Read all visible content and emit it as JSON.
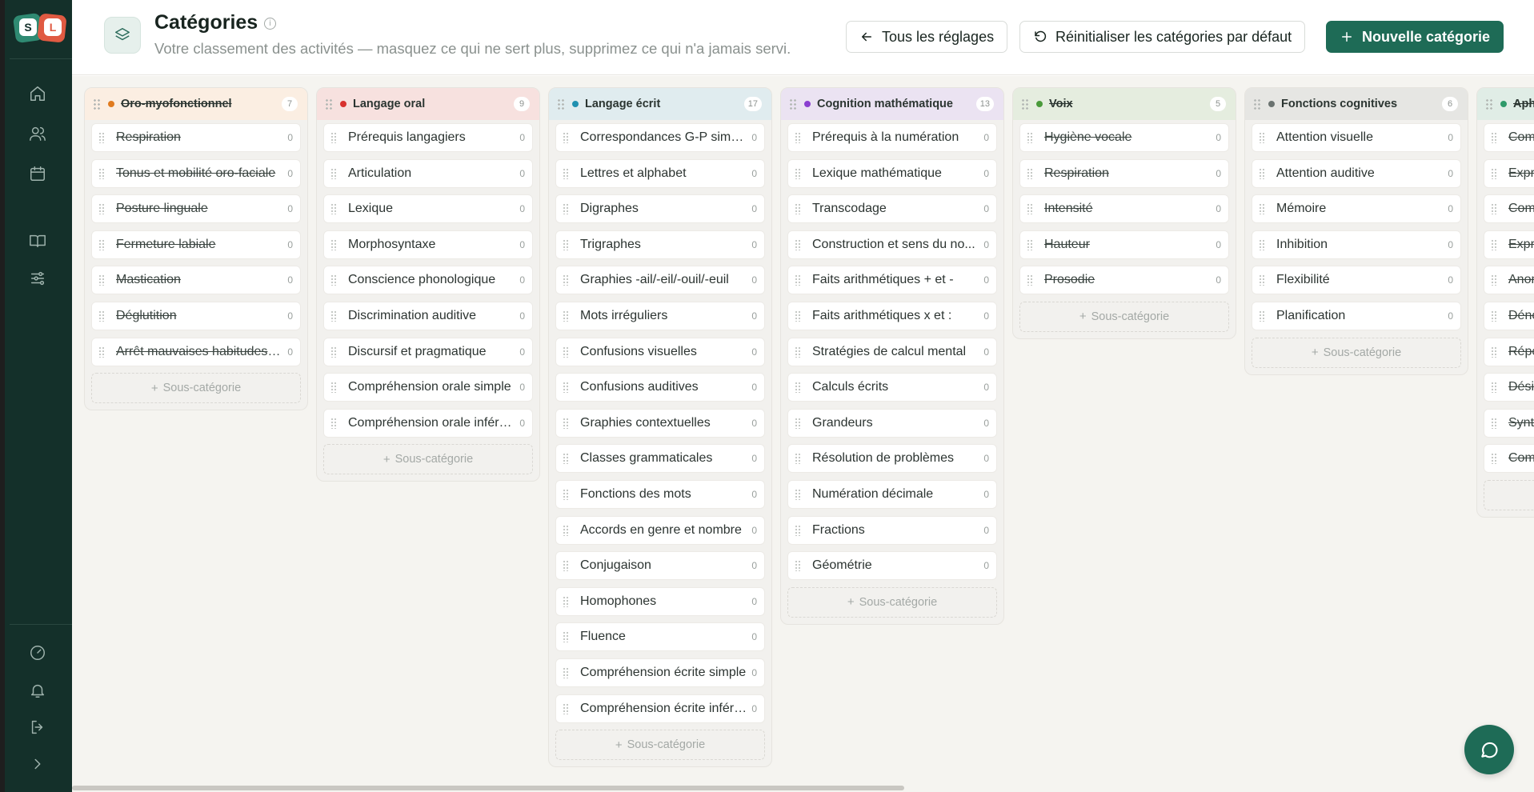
{
  "header": {
    "title": "Catégories",
    "subtitle": "Votre classement des activités — masquez ce qui ne sert plus, supprimez ce qui n'a jamais servi.",
    "back_label": "Tous les réglages",
    "reset_label": "Réinitialiser les catégories par défaut",
    "new_label": "Nouvelle catégorie"
  },
  "add_sub_label": "Sous-catégorie",
  "columns": [
    {
      "name": "Oro-myofonctionnel",
      "count": "7",
      "color": "#e07b1f",
      "head_bg": "#fbeee2",
      "archived": true,
      "items": [
        {
          "label": "Respiration",
          "count": "0",
          "archived": true
        },
        {
          "label": "Tonus et mobilité oro-faciale",
          "count": "0",
          "archived": true
        },
        {
          "label": "Posture linguale",
          "count": "0",
          "archived": true
        },
        {
          "label": "Fermeture labiale",
          "count": "0",
          "archived": true
        },
        {
          "label": "Mastication",
          "count": "0",
          "archived": true
        },
        {
          "label": "Déglutition",
          "count": "0",
          "archived": true
        },
        {
          "label": "Arrêt mauvaises habitudes ?...",
          "count": "0",
          "archived": true
        }
      ]
    },
    {
      "name": "Langage oral",
      "count": "9",
      "color": "#d8322f",
      "head_bg": "#f7e1df",
      "archived": false,
      "items": [
        {
          "label": "Prérequis langagiers",
          "count": "0"
        },
        {
          "label": "Articulation",
          "count": "0"
        },
        {
          "label": "Lexique",
          "count": "0"
        },
        {
          "label": "Morphosyntaxe",
          "count": "0"
        },
        {
          "label": "Conscience phonologique",
          "count": "0"
        },
        {
          "label": "Discrimination auditive",
          "count": "0"
        },
        {
          "label": "Discursif et pragmatique",
          "count": "0"
        },
        {
          "label": "Compréhension orale simple",
          "count": "0"
        },
        {
          "label": "Compréhension orale infére...",
          "count": "0"
        }
      ]
    },
    {
      "name": "Langage écrit",
      "count": "17",
      "color": "#1f90b0",
      "head_bg": "#e0ecef",
      "archived": false,
      "items": [
        {
          "label": "Correspondances G-P simpl...",
          "count": "0"
        },
        {
          "label": "Lettres et alphabet",
          "count": "0"
        },
        {
          "label": "Digraphes",
          "count": "0"
        },
        {
          "label": "Trigraphes",
          "count": "0"
        },
        {
          "label": "Graphies -ail/-eil/-ouil/-euil",
          "count": "0"
        },
        {
          "label": "Mots irréguliers",
          "count": "0"
        },
        {
          "label": "Confusions visuelles",
          "count": "0"
        },
        {
          "label": "Confusions auditives",
          "count": "0"
        },
        {
          "label": "Graphies contextuelles",
          "count": "0"
        },
        {
          "label": "Classes grammaticales",
          "count": "0"
        },
        {
          "label": "Fonctions des mots",
          "count": "0"
        },
        {
          "label": "Accords en genre et nombre",
          "count": "0"
        },
        {
          "label": "Conjugaison",
          "count": "0"
        },
        {
          "label": "Homophones",
          "count": "0"
        },
        {
          "label": "Fluence",
          "count": "0"
        },
        {
          "label": "Compréhension écrite simple",
          "count": "0"
        },
        {
          "label": "Compréhension écrite inférе...",
          "count": "0"
        }
      ]
    },
    {
      "name": "Cognition mathématique",
      "count": "13",
      "color": "#8a3fd0",
      "head_bg": "#ebe3f2",
      "archived": false,
      "items": [
        {
          "label": "Prérequis à la numération",
          "count": "0"
        },
        {
          "label": "Lexique mathématique",
          "count": "0"
        },
        {
          "label": "Transcodage",
          "count": "0"
        },
        {
          "label": "Construction et sens du no...",
          "count": "0"
        },
        {
          "label": "Faits arithmétiques + et -",
          "count": "0"
        },
        {
          "label": "Faits arithmétiques x et :",
          "count": "0"
        },
        {
          "label": "Stratégies de calcul mental",
          "count": "0"
        },
        {
          "label": "Calculs écrits",
          "count": "0"
        },
        {
          "label": "Grandeurs",
          "count": "0"
        },
        {
          "label": "Résolution de problèmes",
          "count": "0"
        },
        {
          "label": "Numération décimale",
          "count": "0"
        },
        {
          "label": "Fractions",
          "count": "0"
        },
        {
          "label": "Géométrie",
          "count": "0"
        }
      ]
    },
    {
      "name": "Voix",
      "count": "5",
      "color": "#4a9a3a",
      "head_bg": "#e5eddf",
      "archived": true,
      "items": [
        {
          "label": "Hygiène vocale",
          "count": "0",
          "archived": true
        },
        {
          "label": "Respiration",
          "count": "0",
          "archived": true
        },
        {
          "label": "Intensité",
          "count": "0",
          "archived": true
        },
        {
          "label": "Hauteur",
          "count": "0",
          "archived": true
        },
        {
          "label": "Prosodie",
          "count": "0",
          "archived": true
        }
      ]
    },
    {
      "name": "Fonctions cognitives",
      "count": "6",
      "color": "#6b7370",
      "head_bg": "#e6e6e3",
      "archived": false,
      "items": [
        {
          "label": "Attention visuelle",
          "count": "0"
        },
        {
          "label": "Attention auditive",
          "count": "0"
        },
        {
          "label": "Mémoire",
          "count": "0"
        },
        {
          "label": "Inhibition",
          "count": "0"
        },
        {
          "label": "Flexibilité",
          "count": "0"
        },
        {
          "label": "Planification",
          "count": "0"
        }
      ]
    },
    {
      "name": "Aph",
      "count": "",
      "color": "#2f9a6a",
      "head_bg": "#e0ede6",
      "archived": true,
      "items": [
        {
          "label": "Comp",
          "count": "",
          "archived": true
        },
        {
          "label": "Expre",
          "count": "",
          "archived": true
        },
        {
          "label": "Comp",
          "count": "",
          "archived": true
        },
        {
          "label": "Expre",
          "count": "",
          "archived": true
        },
        {
          "label": "Anor",
          "count": "",
          "archived": true
        },
        {
          "label": "Déno",
          "count": "",
          "archived": true
        },
        {
          "label": "Répé",
          "count": "",
          "archived": true
        },
        {
          "label": "Désig",
          "count": "",
          "archived": true
        },
        {
          "label": "Synt",
          "count": "",
          "archived": true
        },
        {
          "label": "Comr",
          "count": "",
          "archived": true
        }
      ]
    }
  ],
  "sidebar": {
    "logo_letters": [
      "S",
      "L"
    ],
    "icons": [
      "home-icon",
      "users-icon",
      "calendar-icon",
      "book-icon",
      "sliders-icon",
      "gauge-icon",
      "bell-icon",
      "logout-icon",
      "chevron-right-icon"
    ]
  }
}
